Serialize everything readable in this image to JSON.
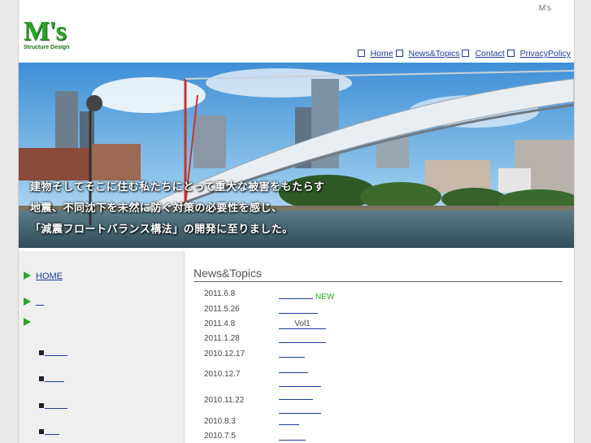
{
  "header": {
    "top_right_text": "M's",
    "logo": {
      "main": "M's",
      "sub": "Structure Design"
    },
    "nav": [
      {
        "label": "Home"
      },
      {
        "label": "News&Topics"
      },
      {
        "label": "Contact"
      },
      {
        "label": "PrivacyPolicy"
      }
    ]
  },
  "hero": {
    "lines": [
      "建物そしてそこに住む私たちにとって重大な被害をもたらす",
      "地震、不同沈下を未然に防ぐ対策の必要性を感じ、",
      "「減震フロートバランス構法」の開発に至りました。"
    ]
  },
  "sidebar": {
    "items": [
      {
        "label": "HOME"
      },
      {
        "label": ""
      },
      {
        "label": ""
      }
    ]
  },
  "news": {
    "heading": "News&Topics",
    "entries": [
      {
        "date": "2011.6.8",
        "text": "",
        "tag": "NEW"
      },
      {
        "date": "2011.5.26",
        "text": ""
      },
      {
        "date": "2011.4.8",
        "text": "Vol1"
      },
      {
        "date": "2011.1.28",
        "text": ""
      },
      {
        "date": "2010.12.17",
        "text": ""
      },
      {
        "date": "2010.12.7",
        "text": ""
      },
      {
        "date": "2010.11.22",
        "text": ""
      },
      {
        "date": "2010.8.3",
        "text": ""
      },
      {
        "date": "2010.7.5",
        "text": ""
      }
    ]
  },
  "colors": {
    "accent_green": "#2aa52a",
    "link_blue": "#1d3a9a"
  }
}
